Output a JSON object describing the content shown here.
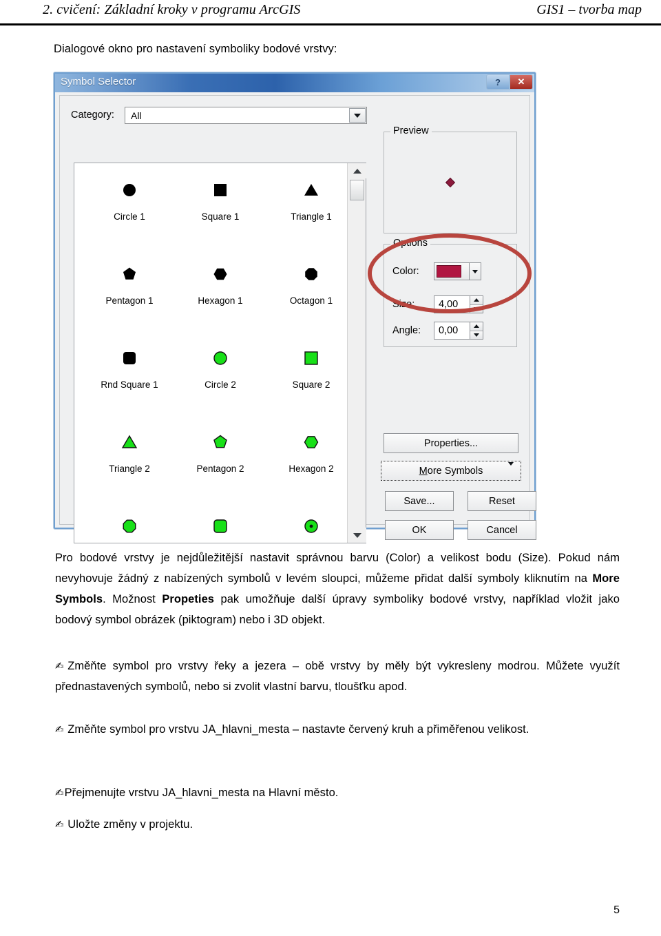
{
  "header": {
    "left": "2. cvičení: Základní kroky v programu ArcGIS",
    "right": "GIS1 – tvorba map"
  },
  "intro": "Dialogové okno pro nastavení symboliky bodové vrstvy:",
  "dialog": {
    "title": "Symbol Selector",
    "titlebar_buttons": [
      {
        "name": "help-button",
        "glyph": "?"
      },
      {
        "name": "close-button",
        "glyph": "✕"
      }
    ],
    "category": {
      "label": "Category:",
      "value": "All",
      "options": [
        "All"
      ]
    },
    "symbols": [
      {
        "label": "Circle 1",
        "shape": "circle",
        "fill": "#000000",
        "stroke": "#000000"
      },
      {
        "label": "Square 1",
        "shape": "square",
        "fill": "#000000",
        "stroke": "#000000"
      },
      {
        "label": "Triangle 1",
        "shape": "triangle",
        "fill": "#000000",
        "stroke": "#000000"
      },
      {
        "label": "Pentagon 1",
        "shape": "pentagon",
        "fill": "#000000",
        "stroke": "#000000"
      },
      {
        "label": "Hexagon 1",
        "shape": "hexagon",
        "fill": "#000000",
        "stroke": "#000000"
      },
      {
        "label": "Octagon 1",
        "shape": "octagon",
        "fill": "#000000",
        "stroke": "#000000"
      },
      {
        "label": "Rnd Square 1",
        "shape": "rndsquare",
        "fill": "#000000",
        "stroke": "#000000"
      },
      {
        "label": "Circle 2",
        "shape": "circle",
        "fill": "#18e018",
        "stroke": "#111111"
      },
      {
        "label": "Square 2",
        "shape": "square",
        "fill": "#18e018",
        "stroke": "#111111"
      },
      {
        "label": "Triangle 2",
        "shape": "triangle",
        "fill": "#18e018",
        "stroke": "#111111"
      },
      {
        "label": "Pentagon 2",
        "shape": "pentagon",
        "fill": "#18e018",
        "stroke": "#111111"
      },
      {
        "label": "Hexagon 2",
        "shape": "hexagon",
        "fill": "#18e018",
        "stroke": "#111111"
      },
      {
        "label": "",
        "shape": "octagon",
        "fill": "#18e018",
        "stroke": "#111111"
      },
      {
        "label": "",
        "shape": "rndsquare",
        "fill": "#18e018",
        "stroke": "#111111"
      },
      {
        "label": "",
        "shape": "circledot",
        "fill": "#18e018",
        "stroke": "#111111"
      }
    ],
    "preview": {
      "legend": "Preview",
      "symbol_color": "#8c1a3c",
      "symbol_shape": "diamond"
    },
    "options": {
      "legend": "Options",
      "color_label": "Color:",
      "color_value": "#b01641",
      "size_label": "Size:",
      "size_value": "4,00",
      "angle_label": "Angle:",
      "angle_value": "0,00"
    },
    "buttons": {
      "properties": "Properties...",
      "more_symbols_prefix": "",
      "more_symbols_underlined": "M",
      "more_symbols_rest": "ore Symbols",
      "save": "Save...",
      "reset": "Reset",
      "ok": "OK",
      "cancel": "Cancel"
    },
    "annotation": {
      "name": "red-highlight-ellipse",
      "color": "#b8453e"
    }
  },
  "body": {
    "paragraph_part1": "Pro bodové vrstvy je nejdůležitější nastavit správnou barvu (Color) a velikost bodu (Size). Pokud nám nevyhovuje žádný z nabízených symbolů v levém sloupci, můžeme přidat další symboly kliknutím na ",
    "paragraph_bold1": "More Symbols",
    "paragraph_part2": ". Možnost ",
    "paragraph_bold2": "Propeties",
    "paragraph_part3": " pak umožňuje další úpravy symboliky bodové vrstvy, například vložit jako bodový symbol obrázek (piktogram) nebo i 3D objekt.",
    "tasks": [
      {
        "bullet": "✍",
        "text": "Změňte symbol pro vrstvy řeky a jezera – obě vrstvy by měly být vykresleny modrou. Můžete využít přednastavených symbolů, nebo si zvolit vlastní barvu, tloušťku apod."
      },
      {
        "bullet": "✍",
        "text": " Změňte symbol pro vrstvu JA_hlavni_mesta – nastavte červený kruh a přiměřenou velikost."
      },
      {
        "bullet": "✍",
        "text": "Přejmenujte vrstvu JA_hlavni_mesta na Hlavní město."
      },
      {
        "bullet": "✍",
        "text": " Uložte změny v projektu."
      }
    ]
  },
  "page_number": "5"
}
